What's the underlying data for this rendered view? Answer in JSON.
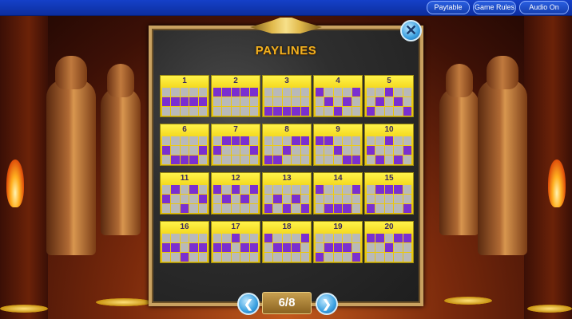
{
  "topbar": {
    "paytable_label": "Paytable",
    "game_rules_label": "Game Rules",
    "audio_label": "Audio On"
  },
  "panel": {
    "title": "PAYLINES",
    "page_indicator": "6/8",
    "close_icon": "close-x-icon",
    "prev_icon": "chevron-left-icon",
    "next_icon": "chevron-right-icon"
  },
  "colors": {
    "active_cell": "#7a2fd0",
    "inactive_cell": "#b9b9b9",
    "card_yellow": "#f0d010",
    "topbar_blue": "#1540c8"
  },
  "paylines": [
    {
      "number": "1",
      "rows": [
        "00000",
        "11111",
        "00000"
      ]
    },
    {
      "number": "2",
      "rows": [
        "11111",
        "00000",
        "00000"
      ]
    },
    {
      "number": "3",
      "rows": [
        "00000",
        "00000",
        "11111"
      ]
    },
    {
      "number": "4",
      "rows": [
        "10001",
        "01010",
        "00100"
      ]
    },
    {
      "number": "5",
      "rows": [
        "00100",
        "01010",
        "10001"
      ]
    },
    {
      "number": "6",
      "rows": [
        "00000",
        "10001",
        "01110"
      ]
    },
    {
      "number": "7",
      "rows": [
        "01110",
        "10001",
        "00000"
      ]
    },
    {
      "number": "8",
      "rows": [
        "00011",
        "00100",
        "11000"
      ]
    },
    {
      "number": "9",
      "rows": [
        "11000",
        "00100",
        "00011"
      ]
    },
    {
      "number": "10",
      "rows": [
        "00100",
        "10001",
        "01010"
      ]
    },
    {
      "number": "11",
      "rows": [
        "01010",
        "10001",
        "00100"
      ]
    },
    {
      "number": "12",
      "rows": [
        "10101",
        "01010",
        "00000"
      ]
    },
    {
      "number": "13",
      "rows": [
        "00000",
        "01010",
        "10101"
      ]
    },
    {
      "number": "14",
      "rows": [
        "10001",
        "00000",
        "01110"
      ]
    },
    {
      "number": "15",
      "rows": [
        "01110",
        "00000",
        "10001"
      ]
    },
    {
      "number": "16",
      "rows": [
        "00000",
        "11011",
        "00100"
      ]
    },
    {
      "number": "17",
      "rows": [
        "00100",
        "11011",
        "00000"
      ]
    },
    {
      "number": "18",
      "rows": [
        "10001",
        "01110",
        "00000"
      ]
    },
    {
      "number": "19",
      "rows": [
        "00000",
        "01110",
        "10001"
      ]
    },
    {
      "number": "20",
      "rows": [
        "11011",
        "00100",
        "00000"
      ]
    }
  ]
}
